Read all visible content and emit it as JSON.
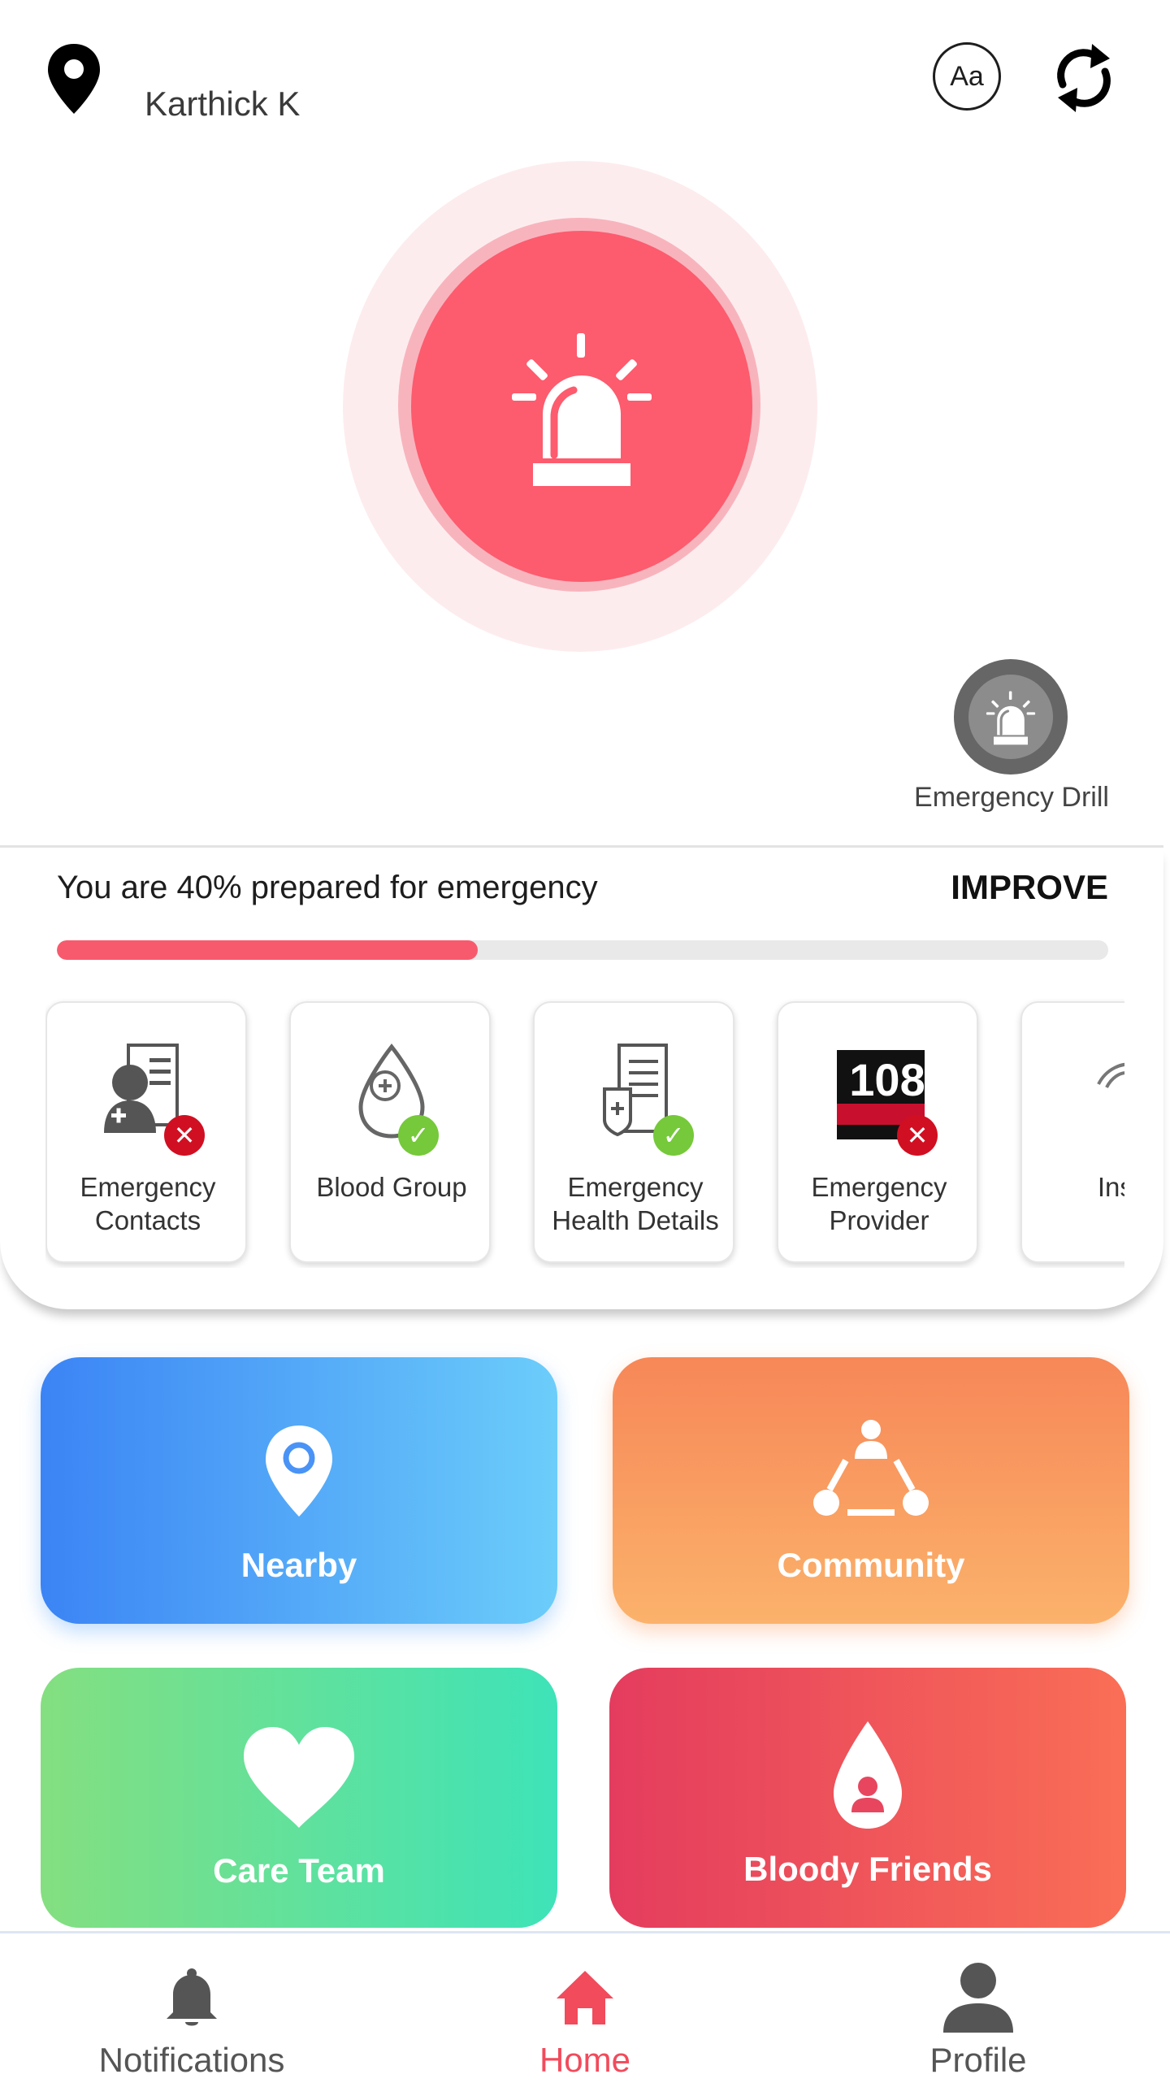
{
  "header": {
    "user_name": "Karthick K",
    "font_button_label": "Aa",
    "location_icon": "map-pin-icon",
    "refresh_icon": "sync-icon"
  },
  "sos": {
    "icon": "siren-icon"
  },
  "drill": {
    "label": "Emergency Drill",
    "icon": "siren-icon"
  },
  "preparedness": {
    "text": "You are 40% prepared for emergency",
    "percent": 40,
    "improve_label": "IMPROVE",
    "items": [
      {
        "label": "Emergency\nContacts",
        "status": "incomplete",
        "icon": "contact-card-icon"
      },
      {
        "label": "Blood Group",
        "status": "complete",
        "icon": "blood-drop-icon"
      },
      {
        "label": "Emergency\nHealth Details",
        "status": "complete",
        "icon": "health-record-icon"
      },
      {
        "label": "Emergency\nProvider",
        "status": "incomplete",
        "icon": "call-108-icon",
        "logo_text": "108"
      },
      {
        "label": "Insu",
        "icon": "insurance-icon"
      }
    ]
  },
  "actions": [
    {
      "label": "Nearby",
      "icon": "map-pin-icon"
    },
    {
      "label": "Community",
      "icon": "community-icon"
    },
    {
      "label": "Care Team",
      "icon": "heart-icon"
    },
    {
      "label": "Bloody Friends",
      "icon": "blood-drop-person-icon"
    }
  ],
  "nav": {
    "items": [
      {
        "label": "Notifications",
        "icon": "bell-icon",
        "active": false
      },
      {
        "label": "Home",
        "icon": "home-icon",
        "active": true
      },
      {
        "label": "Profile",
        "icon": "person-icon",
        "active": false
      }
    ]
  },
  "colors": {
    "accent": "#fd5b6e",
    "nav_active": "#f14b5c",
    "nav_inactive": "#555555",
    "nearby": "#4a9af5",
    "community": "#f9995f",
    "care_team": "#5fe0a0",
    "bloody_friends": "#ee5260"
  }
}
